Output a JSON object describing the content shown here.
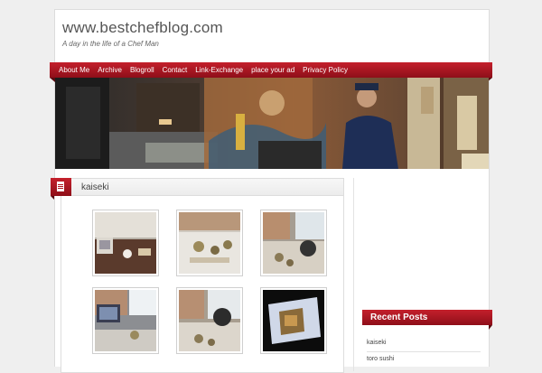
{
  "header": {
    "site_title": "www.bestchefblog.com",
    "tagline": "A day in the life of a Chef Man"
  },
  "nav": {
    "items": [
      "About Me",
      "Archive",
      "Blogroll",
      "Contact",
      "Link-Exchange",
      "place your ad",
      "Privacy Policy"
    ]
  },
  "post": {
    "title": "kaiseki",
    "icon": "document-icon"
  },
  "sidebar": {
    "recent_posts_title": "Recent Posts",
    "recent_posts": [
      "kaiseki",
      "toro sushi"
    ]
  },
  "colors": {
    "accent": "#b0141f",
    "accent_dark": "#5a0a10",
    "page_bg": "#efefef"
  }
}
